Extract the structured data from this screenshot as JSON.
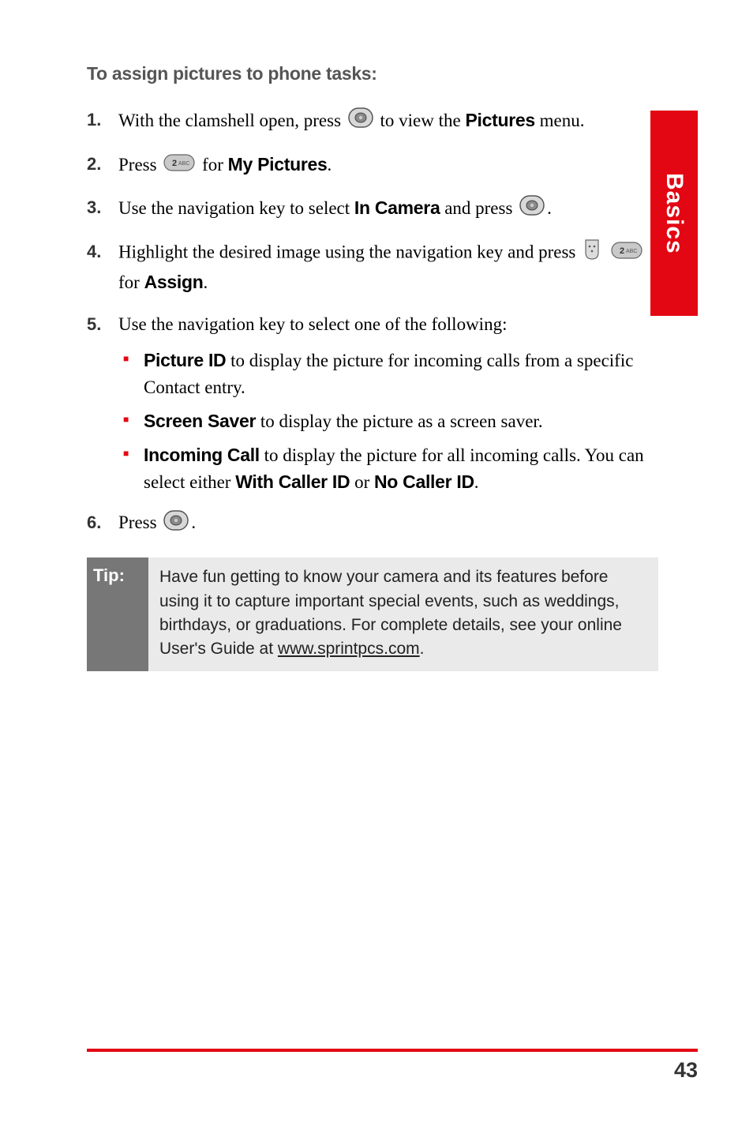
{
  "heading": "To assign pictures to phone tasks:",
  "steps": {
    "s1_a": "With the clamshell open, press ",
    "s1_b": " to view the ",
    "s1_menu": "Pictures",
    "s1_c": " menu.",
    "s2_a": "Press ",
    "s2_b": " for ",
    "s2_item": "My Pictures",
    "s2_c": ".",
    "s3_a": "Use the navigation key to select ",
    "s3_item": "In Camera",
    "s3_b": " and press ",
    "s3_c": ".",
    "s4_a": "Highlight the desired image using the navigation key and press ",
    "s4_b": " ",
    "s4_c": " for ",
    "s4_item": "Assign",
    "s4_d": ".",
    "s5": "Use the navigation key to select one of the following:",
    "s5_sub1_bold": "Picture ID",
    "s5_sub1_text": " to display the picture for incoming calls from a specific Contact entry.",
    "s5_sub2_bold": "Screen Saver",
    "s5_sub2_text": " to display the picture as a screen saver.",
    "s5_sub3_bold": "Incoming Call",
    "s5_sub3_text_a": " to display the picture for all incoming calls. You can select either ",
    "s5_sub3_opt1": "With Caller ID",
    "s5_sub3_text_b": " or ",
    "s5_sub3_opt2": "No Caller ID",
    "s5_sub3_text_c": ".",
    "s6_a": "Press ",
    "s6_b": "."
  },
  "tip": {
    "label": "Tip:",
    "text_a": "Have fun getting to know your camera and its features before using it to capture important special events, such as weddings, birthdays, or graduations. For complete details, see your online User's Guide at ",
    "link": "www.sprintpcs.com",
    "text_b": "."
  },
  "side_tab": "Basics",
  "page_number": "43",
  "icons": {
    "ok_button": "ok-button-icon",
    "key_2abc": "key-2abc-icon",
    "softkey": "softkey-icon"
  }
}
